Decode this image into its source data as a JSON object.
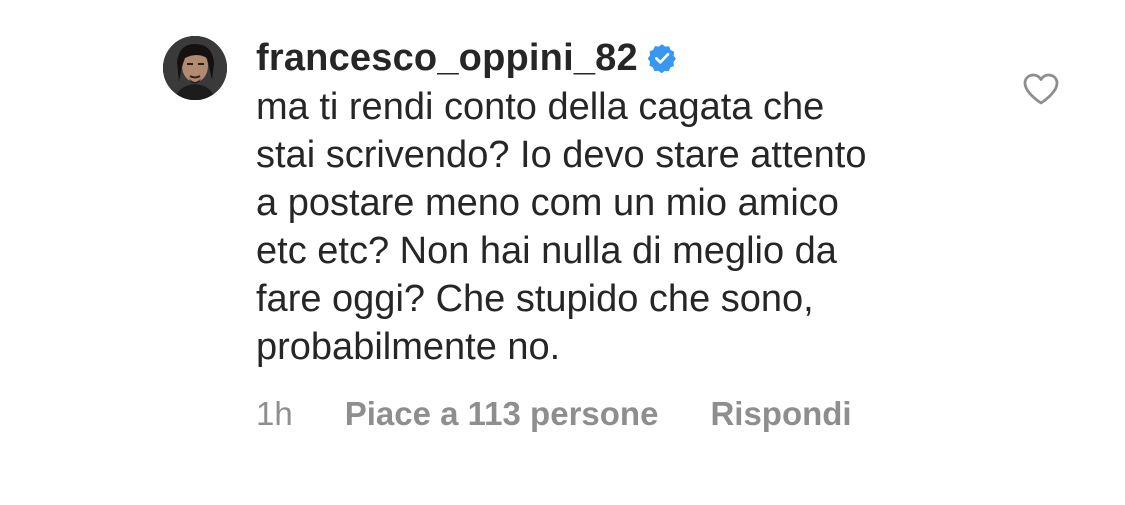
{
  "comment": {
    "username": "francesco_oppini_82",
    "verified_icon": "verified-badge-icon",
    "verified_color": "#3897f0",
    "text": "ma ti rendi conto della cagata che\nstai scrivendo? Io devo stare attento\na postare meno com un mio amico\netc etc? Non hai nulla di meglio da\nfare oggi? Che stupido che sono,\nprobabilmente no.",
    "time": "1h",
    "likes": "Piace a 113 persone",
    "reply_label": "Rispondi",
    "like_icon": "heart-outline-icon"
  },
  "colors": {
    "text_primary": "#262626",
    "text_secondary": "#8e8e8e",
    "icon_gray": "#8e8e8e",
    "background": "#ffffff"
  }
}
